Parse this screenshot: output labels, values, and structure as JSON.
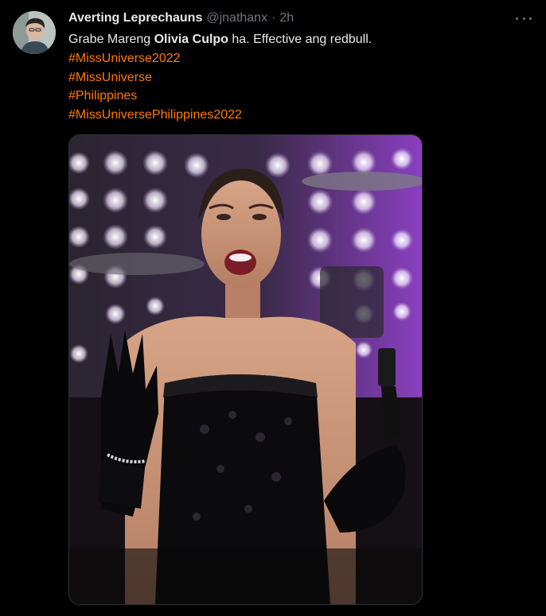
{
  "tweet": {
    "author": {
      "display_name": "Averting Leprechauns",
      "handle": "@jnathanx",
      "separator": "·",
      "time": "2h"
    },
    "text": {
      "part1": "Grabe Mareng ",
      "bold_name": "Olivia Culpo",
      "part2": " ha. Effective ang redbull."
    },
    "hashtags": [
      "#MissUniverse2022",
      "#MissUniverse",
      "#Philippines",
      "#MissUniversePhilippines2022"
    ],
    "media": {
      "description_icon": "photo-media"
    }
  },
  "colors": {
    "background": "#000000",
    "text": "#e7e9ea",
    "secondary": "#71767b",
    "hashtag": "#ff7a00"
  },
  "icons": {
    "more": "more-dots-icon"
  }
}
